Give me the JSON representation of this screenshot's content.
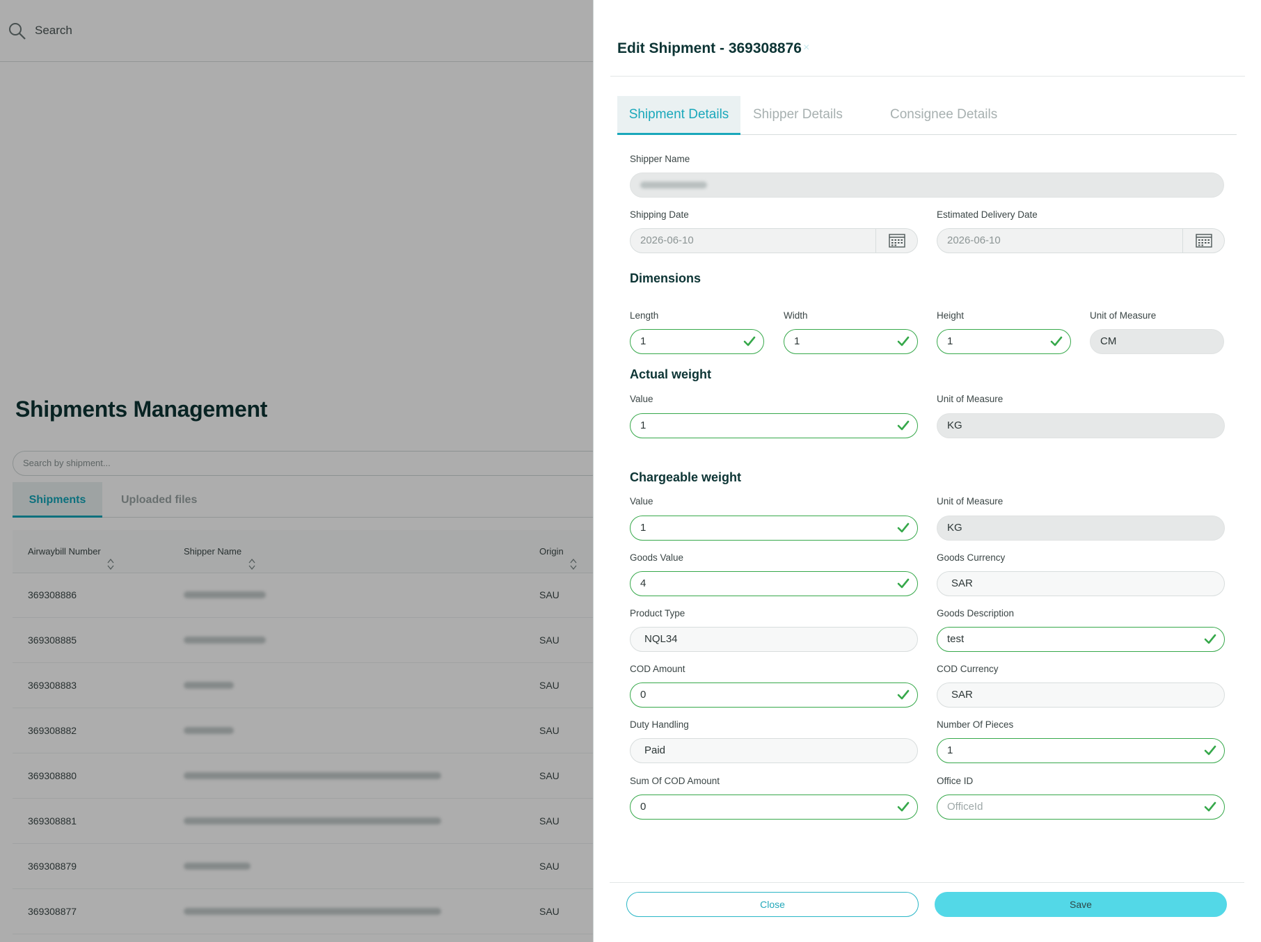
{
  "topbar": {
    "search_label": "Search"
  },
  "page": {
    "title": "Shipments Management",
    "search_placeholder": "Search by shipment...",
    "tabs": [
      "Shipments",
      "Uploaded files"
    ],
    "table": {
      "headers": [
        "Airwaybill Number",
        "Shipper Name",
        "Origin"
      ],
      "rows": [
        {
          "awb": "369308886",
          "origin": "SAU"
        },
        {
          "awb": "369308885",
          "origin": "SAU"
        },
        {
          "awb": "369308883",
          "origin": "SAU"
        },
        {
          "awb": "369308882",
          "origin": "SAU"
        },
        {
          "awb": "369308880",
          "origin": "SAU"
        },
        {
          "awb": "369308881",
          "origin": "SAU"
        },
        {
          "awb": "369308879",
          "origin": "SAU"
        },
        {
          "awb": "369308877",
          "origin": "SAU"
        }
      ]
    }
  },
  "drawer": {
    "title": "Edit Shipment - 369308876",
    "close_glyph": "×",
    "tabs": [
      "Shipment Details",
      "Shipper Details",
      "Consignee Details"
    ],
    "shipper_name_label": "Shipper Name",
    "shipping_date_label": "Shipping Date",
    "shipping_date": "2026-06-10",
    "estimated_delivery_label": "Estimated Delivery Date",
    "estimated_delivery": "2026-06-10",
    "dimensions": {
      "title": "Dimensions",
      "length_label": "Length",
      "length": "1",
      "width_label": "Width",
      "width": "1",
      "height_label": "Height",
      "height": "1",
      "uom_label": "Unit of Measure",
      "uom": "CM"
    },
    "actual_weight": {
      "title": "Actual weight",
      "value_label": "Value",
      "value": "1",
      "uom_label": "Unit of Measure",
      "uom": "KG"
    },
    "chargeable_weight": {
      "title": "Chargeable weight",
      "value_label": "Value",
      "value": "1",
      "uom_label": "Unit of Measure",
      "uom": "KG"
    },
    "goods_value_label": "Goods Value",
    "goods_value": "4",
    "goods_currency_label": "Goods Currency",
    "goods_currency": "SAR",
    "product_type_label": "Product Type",
    "product_type": "NQL34",
    "goods_description_label": "Goods Description",
    "goods_description": "test",
    "cod_amount_label": "COD Amount",
    "cod_amount": "0",
    "cod_currency_label": "COD Currency",
    "cod_currency": "SAR",
    "duty_handling_label": "Duty Handling",
    "duty_handling": "Paid",
    "number_of_pieces_label": "Number Of Pieces",
    "number_of_pieces": "1",
    "sum_cod_label": "Sum Of COD Amount",
    "sum_cod": "0",
    "office_id_label": "Office ID",
    "office_id_placeholder": "OfficeId",
    "close_label": "Close",
    "save_label": "Save",
    "colors": {
      "accent": "#1aa8bb",
      "valid": "#36a84a",
      "save_bg": "#53d8e7"
    }
  }
}
